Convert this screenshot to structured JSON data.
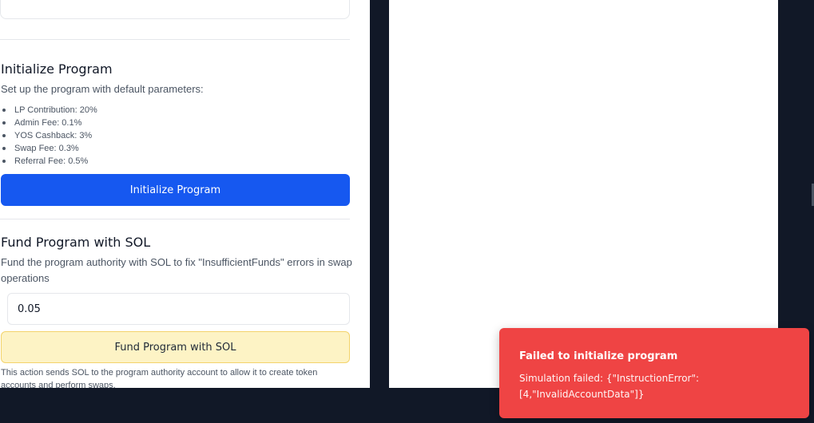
{
  "initialize": {
    "title": "Initialize Program",
    "description": "Set up the program with default parameters:",
    "params": [
      "LP Contribution: 20%",
      "Admin Fee: 0.1%",
      "YOS Cashback: 3%",
      "Swap Fee: 0.3%",
      "Referral Fee: 0.5%"
    ],
    "button_label": "Initialize Program"
  },
  "fund": {
    "title": "Fund Program with SOL",
    "description": "Fund the program authority with SOL to fix \"InsufficientFunds\" errors in swap operations",
    "amount_value": "0.05",
    "button_label": "Fund Program with SOL",
    "note": "This action sends SOL to the program authority account to allow it to create token accounts and perform swaps."
  },
  "toast": {
    "title": "Failed to initialize program",
    "description": "Simulation failed: {\"InstructionError\": [4,\"InvalidAccountData\"]}",
    "color": "#ef4444"
  },
  "colors": {
    "primary": "#1658f0",
    "warning_bg": "#fdf3c5",
    "dark_bg": "#111827"
  }
}
